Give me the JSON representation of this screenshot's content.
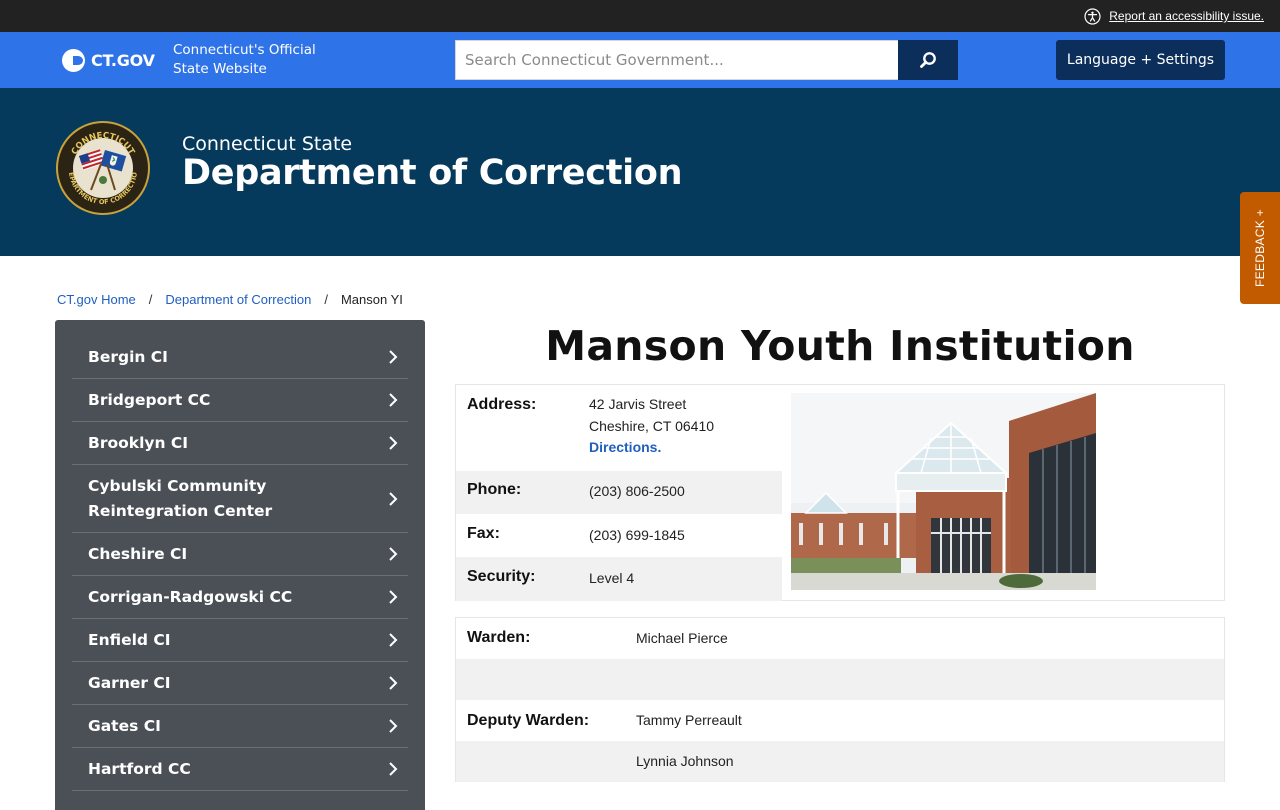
{
  "utility": {
    "accessibility_link": "Report an accessibility issue."
  },
  "ctgov": {
    "brand": "CT.GOV",
    "tagline_line1": "Connecticut's Official",
    "tagline_line2": "State Website",
    "search_placeholder": "Search Connecticut Government...",
    "settings_button": "Language + Settings"
  },
  "agency": {
    "prefix": "Connecticut State",
    "name": "Department of Correction",
    "seal_text_top": "CONNECTICUT",
    "seal_text_bottom": "DEPARTMENT OF CORRECTION"
  },
  "feedback_tab": "FEEDBACK +",
  "breadcrumb": [
    {
      "label": "CT.gov Home"
    },
    {
      "label": "Department of Correction"
    },
    {
      "label": "Manson YI"
    }
  ],
  "breadcrumb_separator": "/",
  "sidebar": {
    "items": [
      {
        "label": "Bergin CI"
      },
      {
        "label": "Bridgeport CC"
      },
      {
        "label": "Brooklyn CI"
      },
      {
        "label": "Cybulski Community Reintegration Center"
      },
      {
        "label": "Cheshire CI"
      },
      {
        "label": "Corrigan-Radgowski CC"
      },
      {
        "label": "Enfield CI"
      },
      {
        "label": "Garner CI"
      },
      {
        "label": "Gates CI"
      },
      {
        "label": "Hartford CC"
      }
    ]
  },
  "facility": {
    "title": "Manson Youth Institution",
    "address_label": "Address:",
    "address_line1": "42 Jarvis Street",
    "address_line2": "Cheshire, CT 06410",
    "directions_link": "Directions.",
    "phone_label": "Phone:",
    "phone": "(203) 806-2500",
    "fax_label": "Fax:",
    "fax": "(203) 699-1845",
    "security_label": "Security:",
    "security": "Level 4"
  },
  "staff": {
    "warden_label": "Warden:",
    "warden": "Michael Pierce",
    "deputy_label": "Deputy Warden:",
    "deputy_1": "Tammy Perreault",
    "deputy_2": "Lynnia Johnson"
  },
  "colors": {
    "ctgov_blue": "#2f73e8",
    "navy": "#0b2e5b",
    "banner": "#053a5c",
    "sidebar": "#4b5057",
    "feedback": "#c25b00",
    "link": "#1f5fbf"
  }
}
